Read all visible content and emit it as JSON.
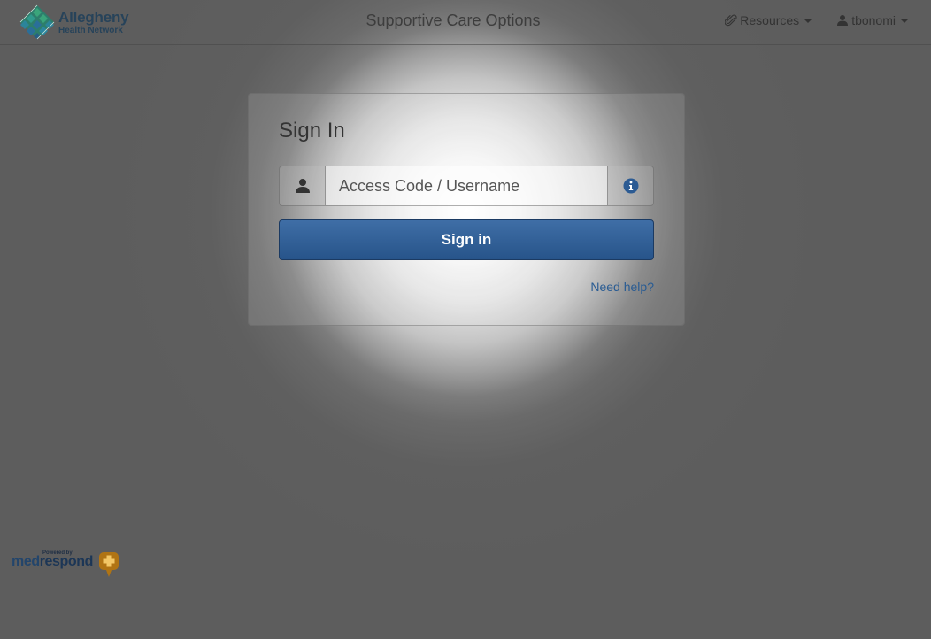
{
  "brand": {
    "name": "Allegheny",
    "sub": "Health Network",
    "logo_icon": "diamond-grid-logo-icon"
  },
  "header": {
    "title": "Supportive Care Options",
    "resources_label": "Resources",
    "resources_icon": "paperclip-icon",
    "user_label": "tbonomi",
    "user_icon": "user-icon"
  },
  "login": {
    "title": "Sign In",
    "username_placeholder": "Access Code / Username",
    "username_value": "",
    "left_addon_icon": "user-icon",
    "right_addon_icon": "info-icon",
    "submit_label": "Sign in",
    "help_label": "Need help?"
  },
  "footer": {
    "powered_by": "Powered by",
    "logo_med": "med",
    "logo_respond": "respond",
    "logo_mark_icon": "medrespond-cross-icon"
  },
  "colors": {
    "primary_button": "#2f5e96",
    "link": "#2a5c93",
    "brand_green": "#2f8a6a",
    "brand_blue": "#27435a",
    "medrespond_orange": "#c07a10"
  }
}
